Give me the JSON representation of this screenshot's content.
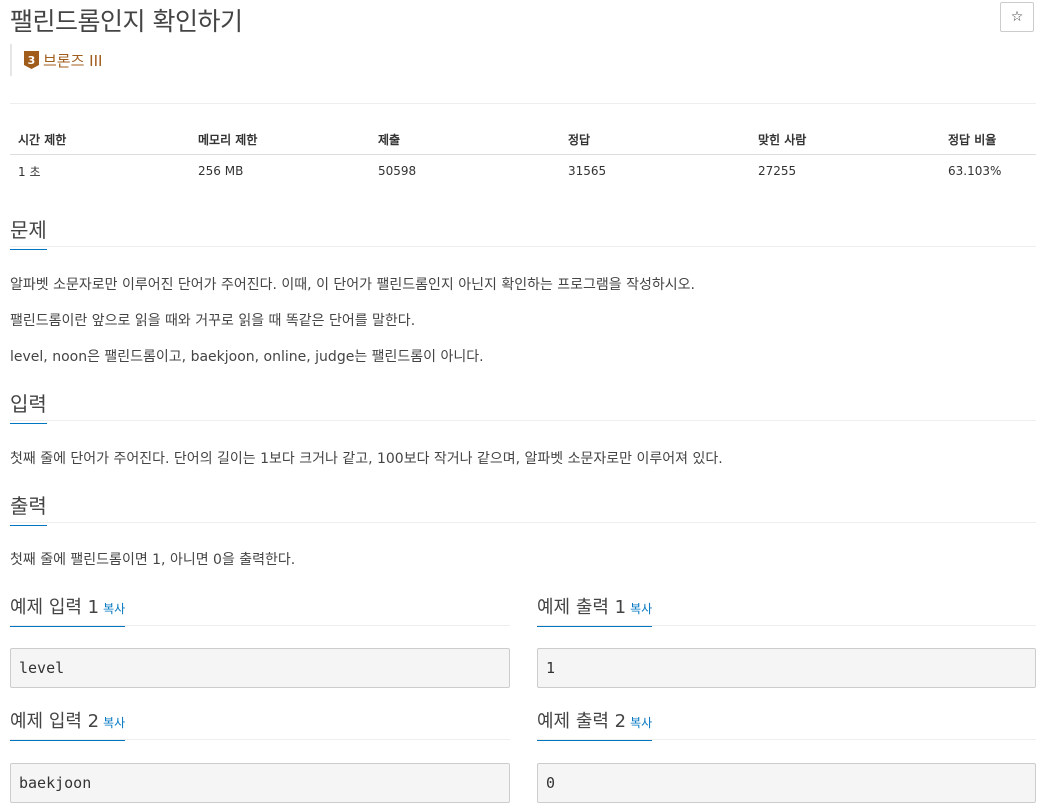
{
  "problem": {
    "title": "팰린드롬인지 확인하기",
    "star_label": "☆",
    "tier_number": "3",
    "tier_label": "브론즈 III"
  },
  "info": {
    "headers": [
      "시간 제한",
      "메모리 제한",
      "제출",
      "정답",
      "맞힌 사람",
      "정답 비율"
    ],
    "values": [
      "1 초",
      "256 MB",
      "50598",
      "31565",
      "27255",
      "63.103%"
    ]
  },
  "sections": {
    "description_title": "문제",
    "description": [
      "알파벳 소문자로만 이루어진 단어가 주어진다. 이때, 이 단어가 팰린드롬인지 아닌지 확인하는 프로그램을 작성하시오.",
      "팰린드롬이란 앞으로 읽을 때와 거꾸로 읽을 때 똑같은 단어를 말한다.",
      "level, noon은 팰린드롬이고, baekjoon, online, judge는 팰린드롬이 아니다."
    ],
    "input_title": "입력",
    "input": "첫째 줄에 단어가 주어진다. 단어의 길이는 1보다 크거나 같고, 100보다 작거나 같으며, 알파벳 소문자로만 이루어져 있다.",
    "output_title": "출력",
    "output": "첫째 줄에 팰린드롬이면 1, 아니면 0을 출력한다."
  },
  "samples": {
    "copy_label": "복사",
    "in1_title": "예제 입력 1",
    "out1_title": "예제 출력 1",
    "in2_title": "예제 입력 2",
    "out2_title": "예제 출력 2",
    "in1": "level",
    "out1": "1",
    "in2": "baekjoon",
    "out2": "0"
  }
}
